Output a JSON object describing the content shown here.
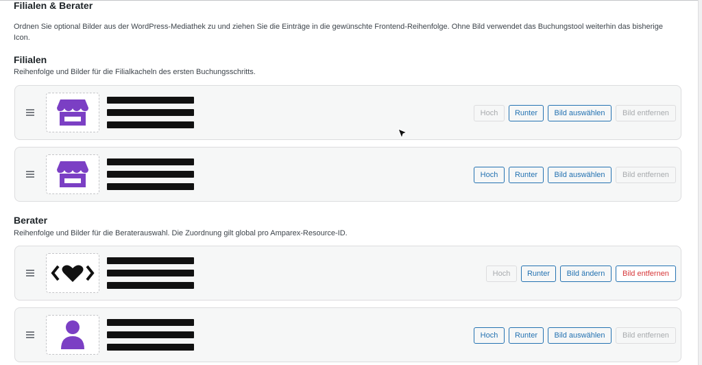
{
  "page": {
    "title": "Filialen & Berater",
    "description": "Ordnen Sie optional Bilder aus der WordPress-Mediathek zu und ziehen Sie die Einträge in die gewünschte Frontend-Reihenfolge. Ohne Bild verwendet das Buchungstool weiterhin das bisherige Icon."
  },
  "filialen": {
    "heading": "Filialen",
    "subtitle": "Reihenfolge und Bilder für die Filialkacheln des ersten Buchungsschritts.",
    "items": [
      {
        "icon": "storefront-icon",
        "btn_up": "Hoch",
        "btn_down": "Runter",
        "btn_image": "Bild auswählen",
        "btn_remove": "Bild entfernen",
        "up_disabled": true,
        "remove_disabled": true
      },
      {
        "icon": "storefront-icon",
        "btn_up": "Hoch",
        "btn_down": "Runter",
        "btn_image": "Bild auswählen",
        "btn_remove": "Bild entfernen",
        "up_disabled": false,
        "remove_disabled": true
      }
    ]
  },
  "berater": {
    "heading": "Berater",
    "subtitle": "Reihenfolge und Bilder für die Beraterauswahl. Die Zuordnung gilt global pro Amparex-Resource-ID.",
    "items": [
      {
        "icon": "code-heart-icon",
        "btn_up": "Hoch",
        "btn_down": "Runter",
        "btn_image": "Bild ändern",
        "btn_remove": "Bild entfernen",
        "up_disabled": true,
        "remove_disabled": false
      },
      {
        "icon": "person-icon",
        "btn_up": "Hoch",
        "btn_down": "Runter",
        "btn_image": "Bild auswählen",
        "btn_remove": "Bild entfernen",
        "up_disabled": false,
        "remove_disabled": true
      }
    ]
  },
  "colors": {
    "accent": "#2271b1",
    "danger": "#d63638",
    "icon_purple": "#7b3fc4"
  }
}
